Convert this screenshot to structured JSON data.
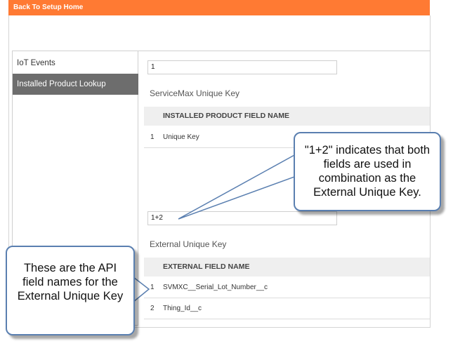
{
  "topbar": {
    "back_label": "Back To Setup Home"
  },
  "sidebar": {
    "items": [
      {
        "label": "IoT Events",
        "active": false
      },
      {
        "label": "Installed Product Lookup",
        "active": true
      }
    ]
  },
  "servicemax_section": {
    "input_value": "1",
    "title": "ServiceMax Unique Key",
    "column_header": "INSTALLED PRODUCT FIELD NAME",
    "rows": [
      {
        "num": "1",
        "value": "Unique Key"
      }
    ]
  },
  "external_section": {
    "input_value": "1+2",
    "title": "External Unique Key",
    "column_header": "EXTERNAL FIELD NAME",
    "rows": [
      {
        "num": "1",
        "value": "SVMXC__Serial_Lot_Number__c"
      },
      {
        "num": "2",
        "value": "Thing_Id__c"
      }
    ]
  },
  "callouts": {
    "combination_note": "\"1+2\" indicates that both fields are used in combination as the External Unique Key.",
    "api_note": "These are the API field names for the External Unique Key"
  },
  "colors": {
    "topbar": "#ff7a33",
    "sidebar_active": "#6d6d6d",
    "callout_border": "#5a7fb0"
  }
}
